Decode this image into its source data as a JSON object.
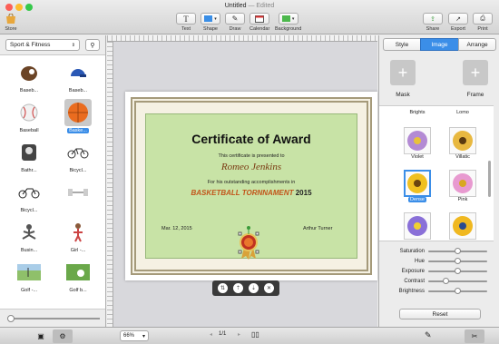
{
  "window": {
    "title": "Untitled",
    "subtitle": "— Edited"
  },
  "toolbar": {
    "store": "Store",
    "text": "Text",
    "shape": "Shape",
    "draw": "Draw",
    "calendar": "Calendar",
    "background": "Background",
    "share": "Share",
    "export": "Export",
    "print": "Print"
  },
  "sidebar": {
    "category": "Sport & Fitness",
    "items": [
      {
        "label": "Baseb...",
        "icon": "baseball-glove-icon"
      },
      {
        "label": "Baseb...",
        "icon": "helmet-icon"
      },
      {
        "label": "Baseball",
        "icon": "baseball-icon"
      },
      {
        "label": "Baske...",
        "icon": "basketball-icon"
      },
      {
        "label": "Bathr...",
        "icon": "scale-icon"
      },
      {
        "label": "Bicycl...",
        "icon": "bicycle-icon"
      },
      {
        "label": "Bicycl...",
        "icon": "bicycle-icon"
      },
      {
        "label": "",
        "icon": "dumbbell-icon"
      },
      {
        "label": "Busin...",
        "icon": "yoga-icon"
      },
      {
        "label": "Girl -...",
        "icon": "girl-icon"
      },
      {
        "label": "Golf -...",
        "icon": "golf-icon"
      },
      {
        "label": "Golf b...",
        "icon": "golf-ball-icon"
      }
    ]
  },
  "certificate": {
    "title": "Certificate of Award",
    "presented": "This certificate is presented to",
    "name": "Romeo Jenkins",
    "for_text": "For his outstanding accomplishments in",
    "event": "BASKETBALL TORNNAMENT",
    "year": "2015",
    "date": "Mar. 12, 2015",
    "signer": "Arthur Turner"
  },
  "right_panel": {
    "tabs": [
      "Style",
      "Image",
      "Arrange"
    ],
    "mask": "Mask",
    "frame": "Frame",
    "filters": [
      {
        "label": "Brights"
      },
      {
        "label": "Lomo"
      },
      {
        "label": "Violet"
      },
      {
        "label": "Villatic"
      },
      {
        "label": "Dense"
      },
      {
        "label": "Pink"
      },
      {
        "label": ""
      },
      {
        "label": ""
      }
    ],
    "sliders": [
      {
        "label": "Saturation",
        "value": 0.5
      },
      {
        "label": "Hue",
        "value": 0.5
      },
      {
        "label": "Exposure",
        "value": 0.5
      },
      {
        "label": "Contrast",
        "value": 0.3
      },
      {
        "label": "Brightness",
        "value": 0.5
      }
    ],
    "reset": "Reset"
  },
  "bottom": {
    "zoom": "66%",
    "page": "1/1"
  },
  "colors": {
    "accent": "#3b8ee8",
    "cert_green": "#c8e3a6"
  }
}
